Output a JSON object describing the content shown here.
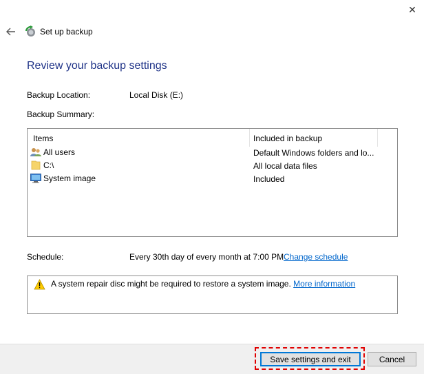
{
  "window": {
    "title": "Set up backup",
    "close_glyph": "✕"
  },
  "page": {
    "heading": "Review your backup settings"
  },
  "settings": {
    "location_label": "Backup Location:",
    "location_value": "Local Disk (E:)",
    "summary_label": "Backup Summary:"
  },
  "table": {
    "headers": [
      "Items",
      "Included in backup"
    ],
    "rows": [
      {
        "icon": "users-icon",
        "name": "All users",
        "included": "Default Windows folders and lo..."
      },
      {
        "icon": "folder-icon",
        "name": "C:\\",
        "included": "All local data files"
      },
      {
        "icon": "monitor-icon",
        "name": "System image",
        "included": "Included"
      }
    ]
  },
  "schedule": {
    "label": "Schedule:",
    "value": "Every 30th day of every month at 7:00 PM",
    "change_link": "Change schedule"
  },
  "warning": {
    "icon": "warning-icon",
    "text": "A system repair disc might be required to restore a system image.",
    "link": "More information"
  },
  "buttons": {
    "save": "Save settings and exit",
    "cancel": "Cancel"
  },
  "colors": {
    "heading": "#1e3287",
    "link": "#0066cc",
    "highlight": "#e00000",
    "footer": "#f0f0f0"
  }
}
